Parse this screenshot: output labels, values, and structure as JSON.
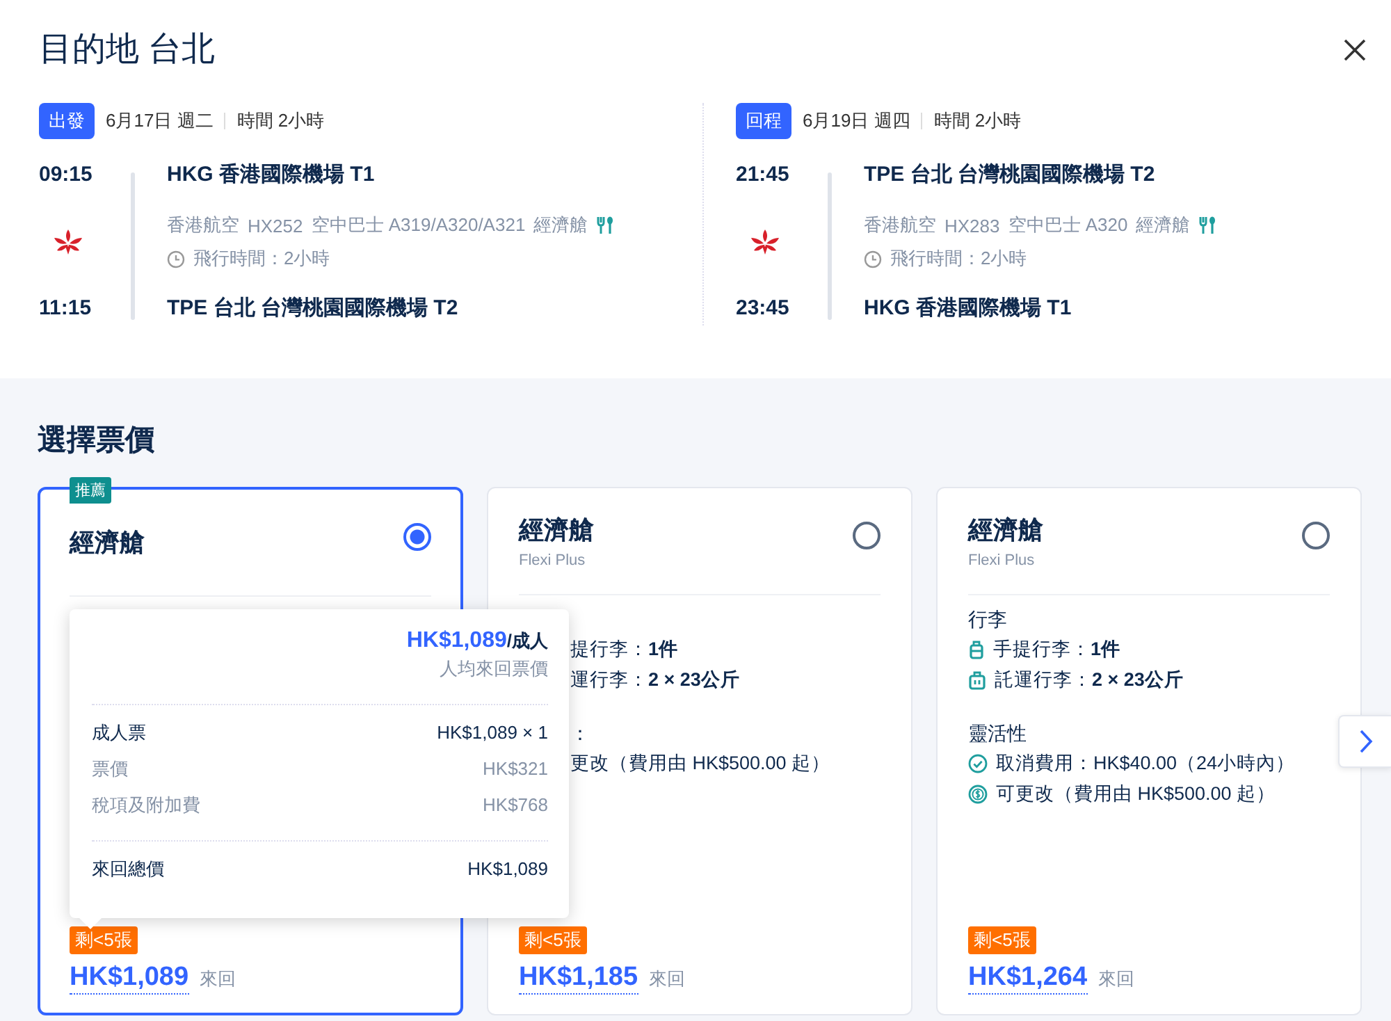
{
  "title": "目的地 台北",
  "legs": [
    {
      "tag": "出發",
      "date": "6月17日 週二",
      "duration": "時間 2小時",
      "depart_time": "09:15",
      "depart_airport": "HKG 香港國際機場 T1",
      "airline": "香港航空",
      "flight": "HX252",
      "aircraft": "空中巴士 A319/A320/A321",
      "cabin": "經濟艙",
      "flight_time": "飛行時間：2小時",
      "arrive_time": "11:15",
      "arrive_airport": "TPE 台北 台灣桃園國際機場 T2"
    },
    {
      "tag": "回程",
      "date": "6月19日 週四",
      "duration": "時間 2小時",
      "depart_time": "21:45",
      "depart_airport": "TPE 台北 台灣桃園國際機場 T2",
      "airline": "香港航空",
      "flight": "HX283",
      "aircraft": "空中巴士 A320",
      "cabin": "經濟艙",
      "flight_time": "飛行時間：2小時",
      "arrive_time": "23:45",
      "arrive_airport": "HKG 香港國際機場 T1"
    }
  ],
  "fares": {
    "heading": "選擇票價",
    "cards": [
      {
        "selected": true,
        "badge": "推薦",
        "cabin": "經濟艙",
        "availability": "剩<5張",
        "price": "HK$1,089",
        "trip": "來回"
      },
      {
        "selected": false,
        "cabin": "經濟艙",
        "subtitle": "Flexi Plus",
        "baggage": {
          "items": [
            {
              "kind": "cut",
              "text": "提行李：**1件**"
            },
            {
              "kind": "cut",
              "text": "運行李：**2 × 23公斤**"
            }
          ]
        },
        "flexibility": {
          "heading": "：",
          "items": [
            {
              "kind": "cut",
              "text": "更改（費用由 HK$500.00 起）"
            }
          ]
        },
        "availability": "剩<5張",
        "price": "HK$1,185",
        "trip": "來回"
      },
      {
        "selected": false,
        "cabin": "經濟艙",
        "subtitle": "Flexi Plus",
        "baggage": {
          "heading": "行李",
          "items": [
            {
              "kind": "carry",
              "text": "手提行李：**1件**"
            },
            {
              "kind": "checked",
              "text": "託運行李：**2 × 23公斤**"
            }
          ]
        },
        "flexibility": {
          "heading": "靈活性",
          "items": [
            {
              "kind": "cancel",
              "text": "取消費用：HK$40.00（24小時內）"
            },
            {
              "kind": "change",
              "text": "可更改（費用由 HK$500.00 起）"
            }
          ]
        },
        "availability": "剩<5張",
        "price": "HK$1,264",
        "trip": "來回"
      }
    ],
    "tooltip": {
      "price": "HK$1,089",
      "unit": "/成人",
      "note": "人均來回票價",
      "rows": [
        {
          "kind": "main",
          "label": "成人票",
          "value": "HK$1,089 × 1"
        },
        {
          "kind": "sub",
          "label": "票價",
          "value": "HK$321"
        },
        {
          "kind": "sub",
          "label": "稅項及附加費",
          "value": "HK$768"
        }
      ],
      "total_label": "來回總價",
      "total_value": "HK$1,089"
    }
  }
}
